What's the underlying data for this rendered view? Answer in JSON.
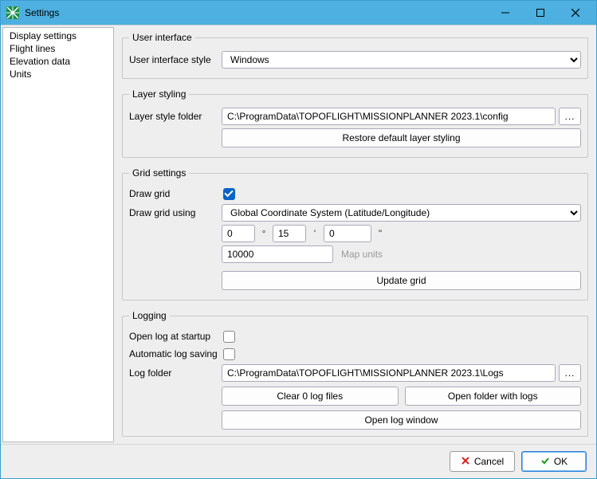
{
  "window": {
    "title": "Settings"
  },
  "sidebar": {
    "items": [
      {
        "label": "Display settings"
      },
      {
        "label": "Flight lines"
      },
      {
        "label": "Elevation data"
      },
      {
        "label": "Units"
      }
    ]
  },
  "ui_section": {
    "legend": "User interface",
    "style_label": "User interface style",
    "style_value": "Windows"
  },
  "layer_section": {
    "legend": "Layer styling",
    "folder_label": "Layer style folder",
    "folder_value": "C:\\ProgramData\\TOPOFLIGHT\\MISSIONPLANNER 2023.1\\config",
    "browse": "...",
    "restore_btn": "Restore default layer styling"
  },
  "grid_section": {
    "legend": "Grid settings",
    "draw_grid_label": "Draw grid",
    "draw_grid_checked": true,
    "draw_using_label": "Draw grid using",
    "draw_using_value": "Global Coordinate System (Latitude/Longitude)",
    "deg": "0",
    "deg_sym": "°",
    "min": "15",
    "min_sym": "'",
    "sec": "0",
    "sec_sym": "\"",
    "map_units_value": "10000",
    "map_units_hint": "Map units",
    "update_btn": "Update grid"
  },
  "log_section": {
    "legend": "Logging",
    "open_startup_label": "Open log at startup",
    "open_startup_checked": false,
    "autosave_label": "Automatic log saving",
    "autosave_checked": false,
    "folder_label": "Log folder",
    "folder_value": "C:\\ProgramData\\TOPOFLIGHT\\MISSIONPLANNER 2023.1\\Logs",
    "browse": "...",
    "clear_btn": "Clear 0 log files",
    "open_folder_btn": "Open folder with logs",
    "open_window_btn": "Open log window"
  },
  "footer": {
    "cancel": "Cancel",
    "ok": "OK"
  }
}
